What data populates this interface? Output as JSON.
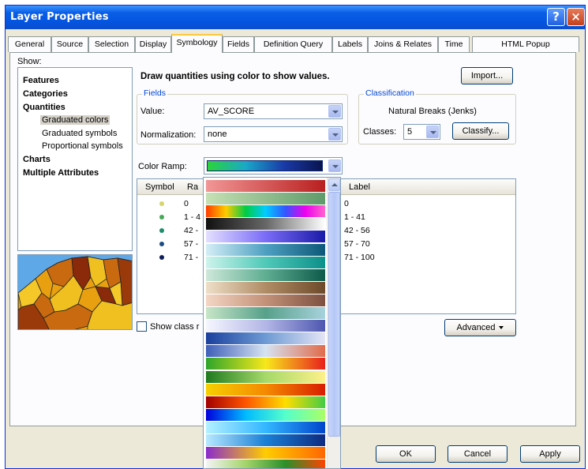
{
  "window": {
    "title": "Layer Properties",
    "help_glyph": "?",
    "close_glyph": "×"
  },
  "tabs": [
    {
      "label": "General"
    },
    {
      "label": "Source"
    },
    {
      "label": "Selection"
    },
    {
      "label": "Display"
    },
    {
      "label": "Symbology"
    },
    {
      "label": "Fields"
    },
    {
      "label": "Definition Query"
    },
    {
      "label": "Labels"
    },
    {
      "label": "Joins & Relates"
    },
    {
      "label": "Time"
    },
    {
      "label": "HTML Popup"
    }
  ],
  "active_tab": "Symbology",
  "show": {
    "label": "Show:",
    "items": [
      {
        "label": "Features"
      },
      {
        "label": "Categories"
      },
      {
        "label": "Quantities"
      },
      {
        "label": "Graduated colors"
      },
      {
        "label": "Graduated symbols"
      },
      {
        "label": "Proportional symbols"
      },
      {
        "label": "Charts"
      },
      {
        "label": "Multiple Attributes"
      }
    ],
    "selected": "Graduated colors"
  },
  "heading": "Draw quantities using color to show values.",
  "import_label": "Import...",
  "fields": {
    "legend": "Fields",
    "value_label": "Value:",
    "value": "AV_SCORE",
    "normalization_label": "Normalization:",
    "normalization": "none"
  },
  "classification": {
    "legend": "Classification",
    "method": "Natural Breaks (Jenks)",
    "classes_label": "Classes:",
    "classes": "5",
    "classify_label": "Classify..."
  },
  "color_ramp_label": "Color Ramp:",
  "table": {
    "headers": {
      "symbol": "Symbol",
      "range": "Ra",
      "label": "Label"
    },
    "rows": [
      {
        "range": "0",
        "label": "0",
        "color": "#d5d56c"
      },
      {
        "range": "1 - 4",
        "label": "1 - 41",
        "color": "#44aa55"
      },
      {
        "range": "42 -",
        "label": "42 - 56",
        "color": "#1d8d6a"
      },
      {
        "range": "57 -",
        "label": "57 - 70",
        "color": "#1b4d84"
      },
      {
        "range": "71 -",
        "label": "71 - 100",
        "color": "#0e1c5a"
      }
    ]
  },
  "show_class_label": "Show class r",
  "advanced_label": "Advanced",
  "buttons": {
    "ok": "OK",
    "cancel": "Cancel",
    "apply": "Apply"
  },
  "colors": {
    "title_bar": "#0a5fe6",
    "dialog_bg": "#ece9d8",
    "selection_border": "#ffc83c",
    "group_title": "#0046d5"
  },
  "ramps": [
    "linear-gradient(90deg,#f29696,#b91f1f)",
    "linear-gradient(90deg,#c6e0b4,#5f9a6a)",
    "linear-gradient(90deg,#ff3b00,#ffcc00,#00cc44,#00ccff,#3355ff,#ee00ee,#ff66cc)",
    "linear-gradient(90deg,#111,#666,#fff)",
    "linear-gradient(90deg,#e4e0ff,#7a6cf7,#1a1aa8)",
    "linear-gradient(90deg,#d4eef6,#4ea0c2,#0d5878)",
    "linear-gradient(90deg,#cdf4ec,#4fc9b8,#0c8f8a)",
    "linear-gradient(90deg,#cfe8da,#5fae92,#0e5a4a)",
    "linear-gradient(90deg,#eedfc8,#b08c66,#6d4a2a)",
    "linear-gradient(90deg,#f4d6c4,#c39178,#7d5040)",
    "linear-gradient(90deg,#c7e6c8,#57a08a,#a7d2dc)",
    "linear-gradient(90deg,#f6f6ff,#b3b6e6,#4e57b0)",
    "linear-gradient(90deg,#1a3f9e,#6d9ad4,#e4e4f6)",
    "linear-gradient(90deg,#3e5fb8,#d6e3f2,#e06b4a)",
    "linear-gradient(90deg,#2da52a,#f7e81b,#e8201c)",
    "linear-gradient(90deg,#1f7a1f,#a6d96a,#fef08a)",
    "linear-gradient(90deg,#f6d000,#f48a00,#d81e00)",
    "linear-gradient(90deg,#a30000,#ff5500,#ffdd00,#44cc44)",
    "linear-gradient(90deg,#0000dd,#00bbff,#55ffcc,#aaff66)",
    "linear-gradient(90deg,#b3f0ff,#33b7ff,#0044cc)",
    "linear-gradient(90deg,#b7e9ff,#1a7fd6,#0c2a80)",
    "linear-gradient(90deg,#8a2bcc,#ffcc00,#ff6600)",
    "linear-gradient(90deg,#f4f4f4,#a3d46a,#2a8f2a,#ff4400)"
  ]
}
